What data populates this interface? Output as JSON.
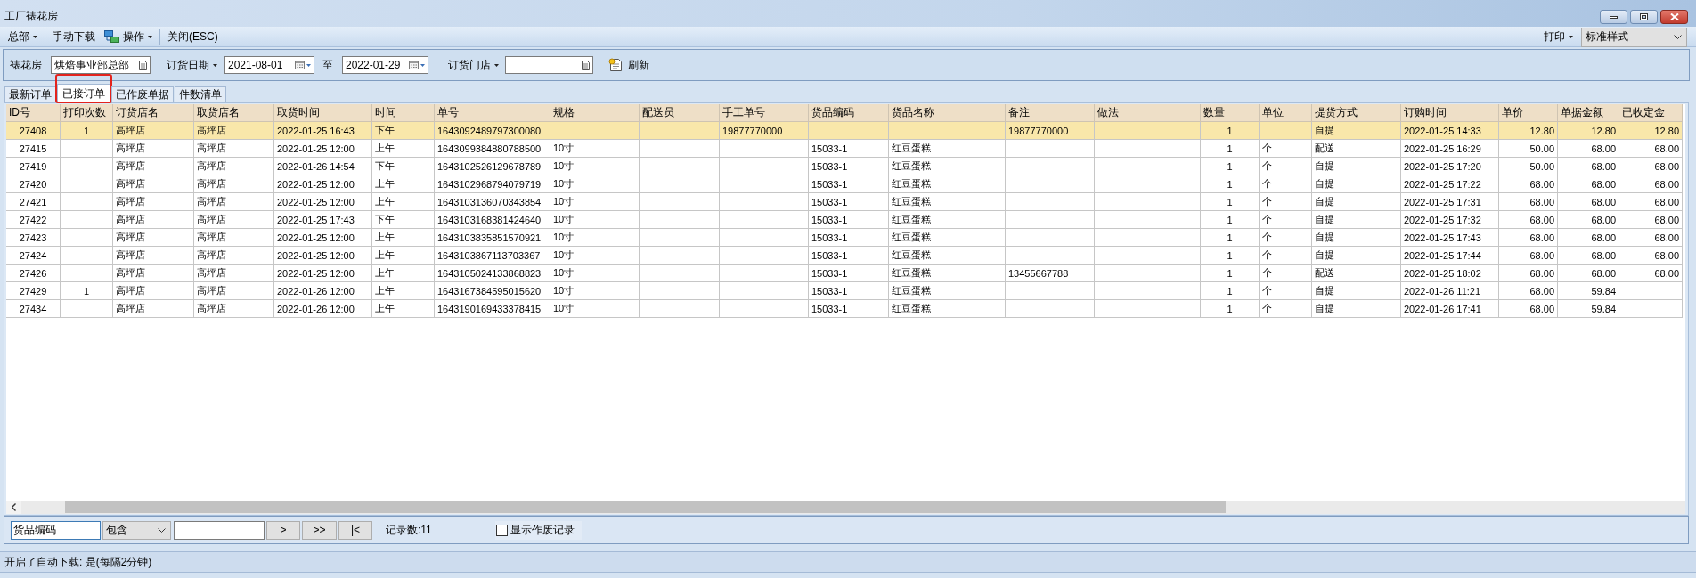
{
  "window": {
    "title": "工厂裱花房"
  },
  "toolbar": {
    "groups": [
      [
        {
          "label": "总部",
          "kind": "menu"
        }
      ],
      [
        {
          "label": "手动下载",
          "kind": "button"
        },
        {
          "label": "操作",
          "kind": "icon-menu"
        }
      ],
      [
        {
          "label": "关闭(ESC)",
          "kind": "button"
        }
      ]
    ],
    "print_menu": "打印",
    "print_style": "标准样式"
  },
  "filters": {
    "shop": {
      "label": "裱花房",
      "value": "烘焙事业部总部"
    },
    "order_date": {
      "label": "订货日期",
      "from": "2021-08-01",
      "to_label": "至",
      "to": "2022-01-29"
    },
    "store": {
      "label": "订货门店"
    },
    "refresh": "刷新"
  },
  "tabs": [
    {
      "label": "最新订单",
      "selected": false,
      "outlined": false
    },
    {
      "label": "已接订单",
      "selected": true,
      "outlined": true
    },
    {
      "label": "已作废单据",
      "selected": false,
      "outlined": false
    },
    {
      "label": "件数清单",
      "selected": false,
      "outlined": false
    }
  ],
  "table": {
    "columns": [
      "ID号",
      "打印次数",
      "订货店名",
      "取货店名",
      "取货时间",
      "时间",
      "单号",
      "规格",
      "配送员",
      "手工单号",
      "货品编码",
      "货品名称",
      "备注",
      "做法",
      "数量",
      "单位",
      "提货方式",
      "订购时间",
      "单价",
      "单据金额",
      "已收定金"
    ],
    "rows": [
      {
        "selected": true,
        "id": "27408",
        "print_count": "1",
        "order_store": "高坪店",
        "pickup_store": "高坪店",
        "pickup_time": "2022-01-25 16:43",
        "period": "下午",
        "order_no": "1643092489797300080",
        "manual_no": "19877770000",
        "remark": "19877770000",
        "quantity": "1",
        "delivery": "自提",
        "order_time": "2022-01-25 14:33",
        "unit_price": "12.80",
        "amount": "12.80",
        "deposit": "12.80"
      },
      {
        "selected": false,
        "id": "27415",
        "order_store": "高坪店",
        "pickup_store": "高坪店",
        "pickup_time": "2022-01-25 12:00",
        "period": "上午",
        "order_no": "1643099384880788500",
        "size": "10寸",
        "item_code": "15033-1",
        "item_name": "红豆蛋糕",
        "quantity": "1",
        "unit": "个",
        "delivery": "配送",
        "order_time": "2022-01-25 16:29",
        "unit_price": "50.00",
        "amount": "68.00",
        "deposit": "68.00"
      },
      {
        "selected": false,
        "id": "27419",
        "order_store": "高坪店",
        "pickup_store": "高坪店",
        "pickup_time": "2022-01-26 14:54",
        "period": "下午",
        "order_no": "1643102526129678789",
        "size": "10寸",
        "item_code": "15033-1",
        "item_name": "红豆蛋糕",
        "quantity": "1",
        "unit": "个",
        "delivery": "自提",
        "order_time": "2022-01-25 17:20",
        "unit_price": "50.00",
        "amount": "68.00",
        "deposit": "68.00"
      },
      {
        "selected": false,
        "id": "27420",
        "order_store": "高坪店",
        "pickup_store": "高坪店",
        "pickup_time": "2022-01-25 12:00",
        "period": "上午",
        "order_no": "1643102968794079719",
        "size": "10寸",
        "item_code": "15033-1",
        "item_name": "红豆蛋糕",
        "quantity": "1",
        "unit": "个",
        "delivery": "自提",
        "order_time": "2022-01-25 17:22",
        "unit_price": "68.00",
        "amount": "68.00",
        "deposit": "68.00"
      },
      {
        "selected": false,
        "id": "27421",
        "order_store": "高坪店",
        "pickup_store": "高坪店",
        "pickup_time": "2022-01-25 12:00",
        "period": "上午",
        "order_no": "1643103136070343854",
        "size": "10寸",
        "item_code": "15033-1",
        "item_name": "红豆蛋糕",
        "quantity": "1",
        "unit": "个",
        "delivery": "自提",
        "order_time": "2022-01-25 17:31",
        "unit_price": "68.00",
        "amount": "68.00",
        "deposit": "68.00"
      },
      {
        "selected": false,
        "id": "27422",
        "order_store": "高坪店",
        "pickup_store": "高坪店",
        "pickup_time": "2022-01-25 17:43",
        "period": "下午",
        "order_no": "1643103168381424640",
        "size": "10寸",
        "item_code": "15033-1",
        "item_name": "红豆蛋糕",
        "quantity": "1",
        "unit": "个",
        "delivery": "自提",
        "order_time": "2022-01-25 17:32",
        "unit_price": "68.00",
        "amount": "68.00",
        "deposit": "68.00"
      },
      {
        "selected": false,
        "id": "27423",
        "order_store": "高坪店",
        "pickup_store": "高坪店",
        "pickup_time": "2022-01-25 12:00",
        "period": "上午",
        "order_no": "1643103835851570921",
        "size": "10寸",
        "item_code": "15033-1",
        "item_name": "红豆蛋糕",
        "quantity": "1",
        "unit": "个",
        "delivery": "自提",
        "order_time": "2022-01-25 17:43",
        "unit_price": "68.00",
        "amount": "68.00",
        "deposit": "68.00"
      },
      {
        "selected": false,
        "id": "27424",
        "order_store": "高坪店",
        "pickup_store": "高坪店",
        "pickup_time": "2022-01-25 12:00",
        "period": "上午",
        "order_no": "1643103867113703367",
        "size": "10寸",
        "item_code": "15033-1",
        "item_name": "红豆蛋糕",
        "quantity": "1",
        "unit": "个",
        "delivery": "自提",
        "order_time": "2022-01-25 17:44",
        "unit_price": "68.00",
        "amount": "68.00",
        "deposit": "68.00"
      },
      {
        "selected": false,
        "id": "27426",
        "order_store": "高坪店",
        "pickup_store": "高坪店",
        "pickup_time": "2022-01-25 12:00",
        "period": "上午",
        "order_no": "1643105024133868823",
        "size": "10寸",
        "item_code": "15033-1",
        "item_name": "红豆蛋糕",
        "remark": "13455667788",
        "quantity": "1",
        "unit": "个",
        "delivery": "配送",
        "order_time": "2022-01-25 18:02",
        "unit_price": "68.00",
        "amount": "68.00",
        "deposit": "68.00"
      },
      {
        "selected": false,
        "id": "27429",
        "print_count": "1",
        "order_store": "高坪店",
        "pickup_store": "高坪店",
        "pickup_time": "2022-01-26 12:00",
        "period": "上午",
        "order_no": "1643167384595015620",
        "size": "10寸",
        "item_code": "15033-1",
        "item_name": "红豆蛋糕",
        "quantity": "1",
        "unit": "个",
        "delivery": "自提",
        "order_time": "2022-01-26 11:21",
        "unit_price": "68.00",
        "amount": "59.84"
      },
      {
        "selected": false,
        "id": "27434",
        "order_store": "高坪店",
        "pickup_store": "高坪店",
        "pickup_time": "2022-01-26 12:00",
        "period": "上午",
        "order_no": "1643190169433378415",
        "size": "10寸",
        "item_code": "15033-1",
        "item_name": "红豆蛋糕",
        "quantity": "1",
        "unit": "个",
        "delivery": "自提",
        "order_time": "2022-01-26 17:41",
        "unit_price": "68.00",
        "amount": "59.84"
      }
    ]
  },
  "search_bar": {
    "field": "货品编码",
    "operator": "包含",
    "buttons": [
      ">",
      ">>",
      "|<"
    ],
    "record_count": "记录数:11",
    "show_voided": {
      "label": "显示作废记录",
      "checked": false
    }
  },
  "status_bar": {
    "text": "开启了自动下载: 是(每隔2分钟)"
  }
}
